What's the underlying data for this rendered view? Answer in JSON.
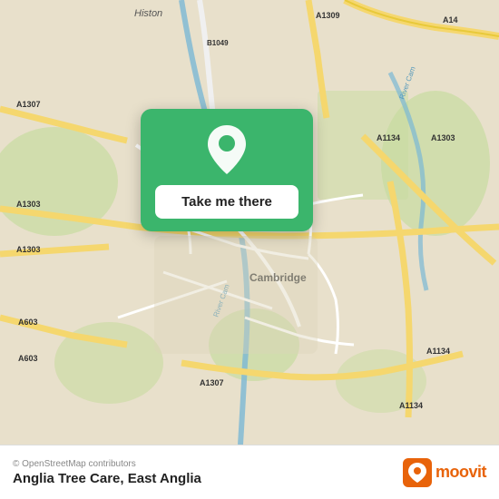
{
  "map": {
    "attribution": "© OpenStreetMap contributors",
    "location_name": "Anglia Tree Care",
    "region": "East Anglia",
    "card": {
      "button_label": "Take me there"
    }
  },
  "footer": {
    "attribution": "© OpenStreetMap contributors",
    "title": "Anglia Tree Care",
    "subtitle": "East Anglia",
    "brand": "moovit"
  },
  "icons": {
    "pin": "📍"
  }
}
